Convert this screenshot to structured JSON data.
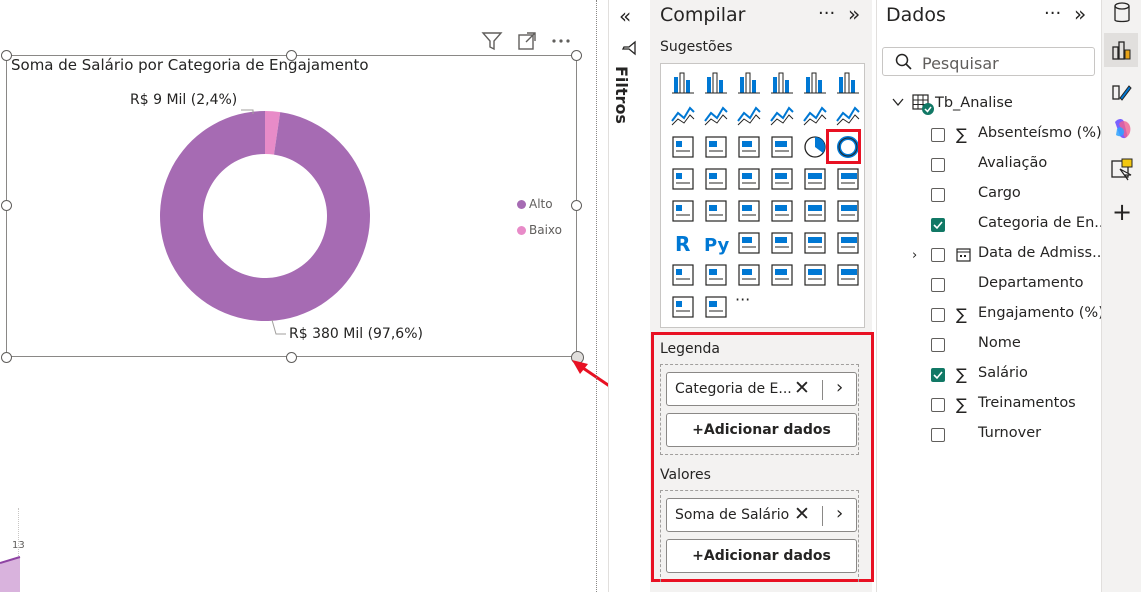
{
  "visual": {
    "title": "Soma de Salário por Categoria de Engajamento",
    "legend": [
      {
        "label": "Alto",
        "color": "#a66bb3"
      },
      {
        "label": "Baixo",
        "color": "#e88bc8"
      }
    ],
    "label_high": "R$ 380 Mil (97,6%)",
    "label_low": "R$ 9 Mil (2,4%)",
    "icons": [
      "filter-icon",
      "focus-mode-icon",
      "more-options-icon"
    ]
  },
  "chart_data": {
    "type": "pie",
    "title": "Soma de Salário por Categoria de Engajamento",
    "categories": [
      "Alto",
      "Baixo"
    ],
    "values": [
      380,
      9
    ],
    "percentages": [
      97.6,
      2.4
    ],
    "labels": [
      "R$ 380 Mil (97,6%)",
      "R$ 9 Mil (2,4%)"
    ],
    "colors": [
      "#a66bb3",
      "#e88bc8"
    ],
    "donut": true,
    "legend_position": "right"
  },
  "mini_chart": {
    "axis_label": "13"
  },
  "filters": {
    "label": "Filtros"
  },
  "build": {
    "title": "Compilar",
    "suggestions_label": "Sugestões",
    "more_visuals": "···",
    "legend_title": "Legenda",
    "legend_field": "Categoria de E...",
    "values_title": "Valores",
    "values_field": "Soma de Salário",
    "add_data": "+Adicionar dados"
  },
  "data": {
    "title": "Dados",
    "search_placeholder": "Pesquisar",
    "table": "Tb_Analise",
    "fields": [
      {
        "label": "Absenteísmo (%)",
        "sigma": true,
        "checked": false
      },
      {
        "label": "Avaliação",
        "sigma": false,
        "checked": false
      },
      {
        "label": "Cargo",
        "sigma": false,
        "checked": false
      },
      {
        "label": "Categoria de En...",
        "sigma": false,
        "checked": true
      },
      {
        "label": "Data de Admiss...",
        "sigma": false,
        "checked": false,
        "calendar": true
      },
      {
        "label": "Departamento",
        "sigma": false,
        "checked": false
      },
      {
        "label": "Engajamento (%)",
        "sigma": true,
        "checked": false
      },
      {
        "label": "Nome",
        "sigma": false,
        "checked": false
      },
      {
        "label": "Salário",
        "sigma": true,
        "checked": true
      },
      {
        "label": "Treinamentos",
        "sigma": true,
        "checked": false
      },
      {
        "label": "Turnover",
        "sigma": false,
        "checked": false
      }
    ]
  },
  "colors": {
    "accent_red": "#e81123",
    "check_green": "#117865",
    "donut_high": "#a66bb3",
    "donut_low": "#e88bc8"
  }
}
